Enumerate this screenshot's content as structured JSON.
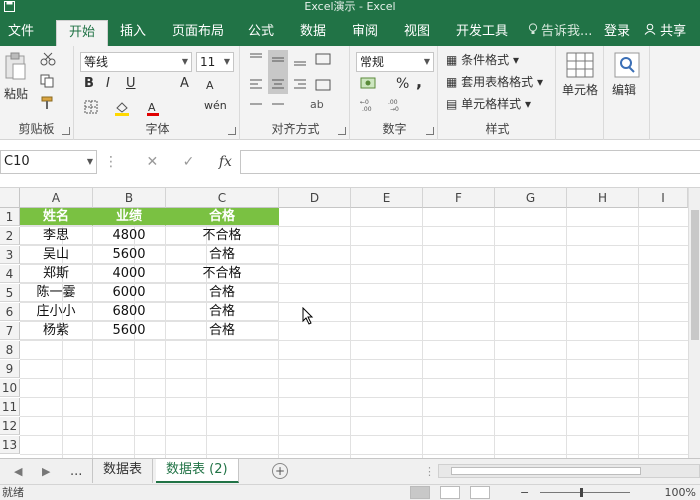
{
  "window": {
    "title": "Excel演示 - Excel"
  },
  "ribbon_tabs": [
    {
      "label": "文件"
    },
    {
      "label": "开始"
    },
    {
      "label": "插入"
    },
    {
      "label": "页面布局"
    },
    {
      "label": "公式"
    },
    {
      "label": "数据"
    },
    {
      "label": "审阅"
    },
    {
      "label": "视图"
    },
    {
      "label": "开发工具"
    }
  ],
  "tell_me": "告诉我...",
  "sign_in": "登录",
  "share": "共享",
  "clipboard": {
    "paste": "粘贴",
    "label": "剪贴板"
  },
  "font": {
    "name": "等线",
    "size": "11",
    "bold": "B",
    "italic": "I",
    "underline": "U",
    "grow": "A",
    "shrink": "A",
    "wen": "wén",
    "label": "字体"
  },
  "alignment": {
    "label": "对齐方式"
  },
  "number": {
    "format": "常规",
    "percent": "%",
    "comma": ",",
    "label": "数字"
  },
  "styles": {
    "conditional": "条件格式",
    "table": "套用表格格式",
    "cell": "单元格样式",
    "label": "样式"
  },
  "cells_group": {
    "label": "单元格"
  },
  "editing_group": {
    "label": "编辑"
  },
  "formula_bar": {
    "name_box": "C10",
    "fx": "fx"
  },
  "columns": [
    "A",
    "B",
    "C",
    "D",
    "E",
    "F",
    "G",
    "H",
    "I"
  ],
  "rows": [
    "1",
    "2",
    "3",
    "4",
    "5",
    "6",
    "7",
    "8",
    "9",
    "10",
    "11",
    "12",
    "13"
  ],
  "table": {
    "headers": [
      "姓名",
      "业绩",
      "合格"
    ],
    "data": [
      [
        "李思",
        "4800",
        "不合格"
      ],
      [
        "吴山",
        "5600",
        "合格"
      ],
      [
        "郑斯",
        "4000",
        "不合格"
      ],
      [
        "陈一霎",
        "6000",
        "合格"
      ],
      [
        "庄小小",
        "6800",
        "合格"
      ],
      [
        "杨紫",
        "5600",
        "合格"
      ]
    ]
  },
  "sheets": [
    {
      "label": "数据表"
    },
    {
      "label": "数据表 (2)"
    }
  ],
  "sheet_nav_more": "...",
  "status": {
    "ready": "就绪",
    "zoom": "100%"
  }
}
